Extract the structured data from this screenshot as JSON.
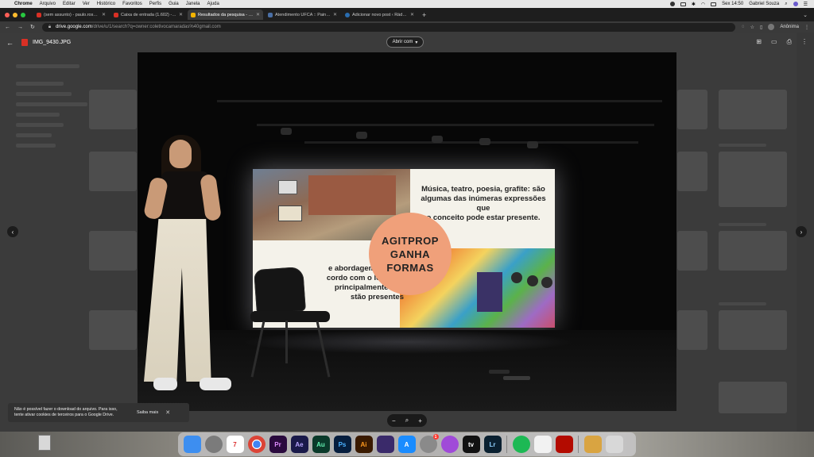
{
  "menubar": {
    "app": "Chrome",
    "items": [
      "Arquivo",
      "Editar",
      "Ver",
      "Histórico",
      "Favoritos",
      "Perfis",
      "Guia",
      "Janela",
      "Ajuda"
    ],
    "clock": "Sex 14:50",
    "user": "Gabriel Souza"
  },
  "tabs": [
    {
      "title": "(sem assunto) - paulo.rosa@c",
      "color": "#d93025"
    },
    {
      "title": "Caixa de entrada (1.602) - pau",
      "color": "#d93025"
    },
    {
      "title": "Resultados da pesquisa - Goo",
      "color": "#f4b400",
      "active": true
    },
    {
      "title": "Atendimento UFCA :: Painel de",
      "color": "#4a6fa5"
    },
    {
      "title": "Adicionar novo post ‹ Rádio C",
      "color": "#2a6db0"
    }
  ],
  "address": {
    "host": "drive.google.com",
    "path": "/drive/u/1/search?q=owner:coletivocamaradas%40gmail.com",
    "profile": "Anônima"
  },
  "viewer": {
    "file_name": "IMG_9430.JPG",
    "open_with": "Abrir com"
  },
  "slide": {
    "text_top": [
      "Música, teatro, poesia, grafite: são",
      "algumas das inúmeras expressões que",
      "o conceito pode estar presente."
    ],
    "badge": [
      "AGITPROP",
      "GANHA",
      "FORMAS"
    ],
    "text_bottom": [
      "e abordagem precisa",
      "cordo com o local, as",
      "principalmente que",
      "stão presentes"
    ]
  },
  "toast": {
    "message": "Não é possível fazer o download do arquivo. Para isso, tente ativar cookies de terceiros para o Google Drive.",
    "learn_more": "Saiba mais"
  },
  "dock": {
    "apps": [
      {
        "name": "finder",
        "label": "",
        "color": "#3d8ef0"
      },
      {
        "name": "launchpad",
        "label": "",
        "color": "#7b7b7b"
      },
      {
        "name": "calendar",
        "label": "7",
        "color": "#ffffff",
        "text": "#d33"
      },
      {
        "name": "chrome",
        "label": "",
        "color": "#e8e8e8"
      },
      {
        "name": "premiere",
        "label": "Pr",
        "color": "#2a0a3e",
        "text": "#e08cff"
      },
      {
        "name": "after-effects",
        "label": "Ae",
        "color": "#1a1a4a",
        "text": "#b9a7ff"
      },
      {
        "name": "audition",
        "label": "Au",
        "color": "#0a3a2a",
        "text": "#62f0b0"
      },
      {
        "name": "photoshop",
        "label": "Ps",
        "color": "#061e3e",
        "text": "#4cb2ff"
      },
      {
        "name": "illustrator",
        "label": "Ai",
        "color": "#3a1a00",
        "text": "#ff9a1f"
      },
      {
        "name": "motion",
        "label": "",
        "color": "#3a2a6a"
      },
      {
        "name": "app-store",
        "label": "A",
        "color": "#1a8cff"
      },
      {
        "name": "system-preferences",
        "label": "",
        "color": "#8a8a8a",
        "badge": "1"
      },
      {
        "name": "podcasts",
        "label": "",
        "color": "#a04ad8"
      },
      {
        "name": "apple-tv",
        "label": "tv",
        "color": "#111111"
      },
      {
        "name": "lightroom",
        "label": "Lr",
        "color": "#0a2030",
        "text": "#8ecfff"
      },
      {
        "name": "spotify",
        "label": "",
        "color": "#1db954"
      },
      {
        "name": "textedit",
        "label": "",
        "color": "#f2f2f2"
      },
      {
        "name": "acrobat",
        "label": "",
        "color": "#b30b00"
      },
      {
        "name": "downloads",
        "label": "",
        "color": "#d9a441"
      },
      {
        "name": "trash",
        "label": "",
        "color": "#d8d8d8"
      }
    ]
  }
}
